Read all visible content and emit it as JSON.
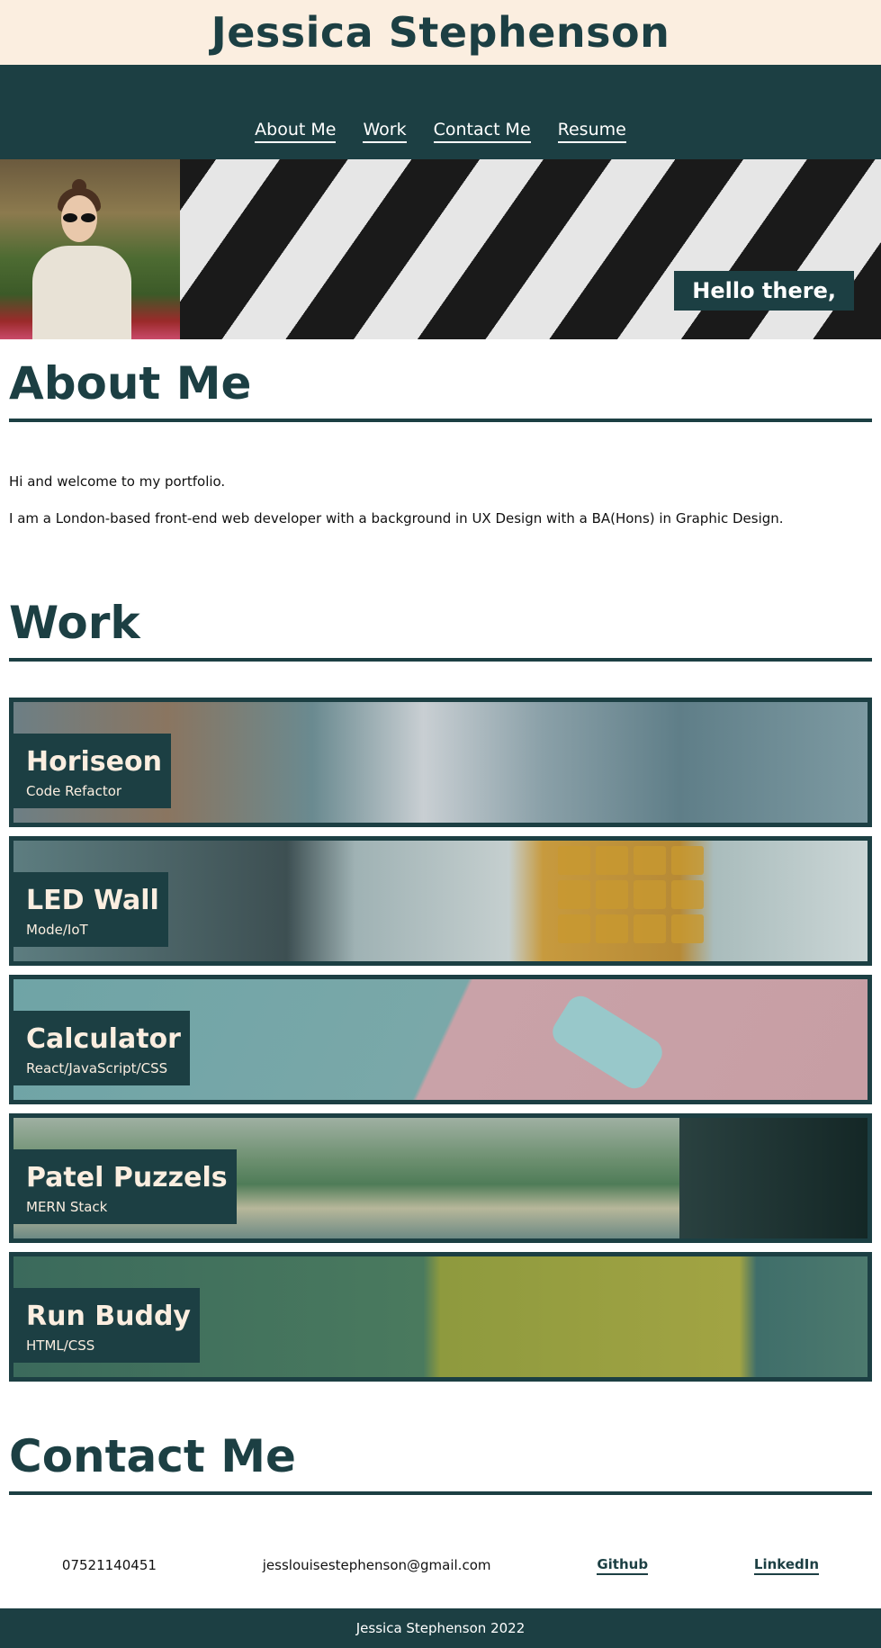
{
  "header": {
    "title": "Jessica Stephenson"
  },
  "nav": {
    "items": [
      {
        "label": "About Me"
      },
      {
        "label": "Work"
      },
      {
        "label": "Contact Me"
      },
      {
        "label": "Resume"
      }
    ]
  },
  "hero": {
    "greeting": "Hello there,"
  },
  "about": {
    "title": "About Me",
    "p1": "Hi and welcome to my portfolio.",
    "p2": "I am a London-based front-end web developer with a background in UX Design with a BA(Hons) in Graphic Design."
  },
  "work": {
    "title": "Work",
    "projects": [
      {
        "name": "Horiseon",
        "tech": "Code Refactor"
      },
      {
        "name": "LED Wall",
        "tech": "Mode/IoT"
      },
      {
        "name": "Calculator",
        "tech": "React/JavaScript/CSS"
      },
      {
        "name": "Patel Puzzels",
        "tech": "MERN Stack"
      },
      {
        "name": "Run Buddy",
        "tech": "HTML/CSS"
      }
    ]
  },
  "contact": {
    "title": "Contact Me",
    "phone": "07521140451",
    "email": "jesslouisestephenson@gmail.com",
    "github": "Github",
    "linkedin": "LinkedIn"
  },
  "footer": {
    "text": "Jessica Stephenson 2022"
  },
  "colors": {
    "primary": "#1c3f43",
    "cream": "#fbeee0"
  }
}
